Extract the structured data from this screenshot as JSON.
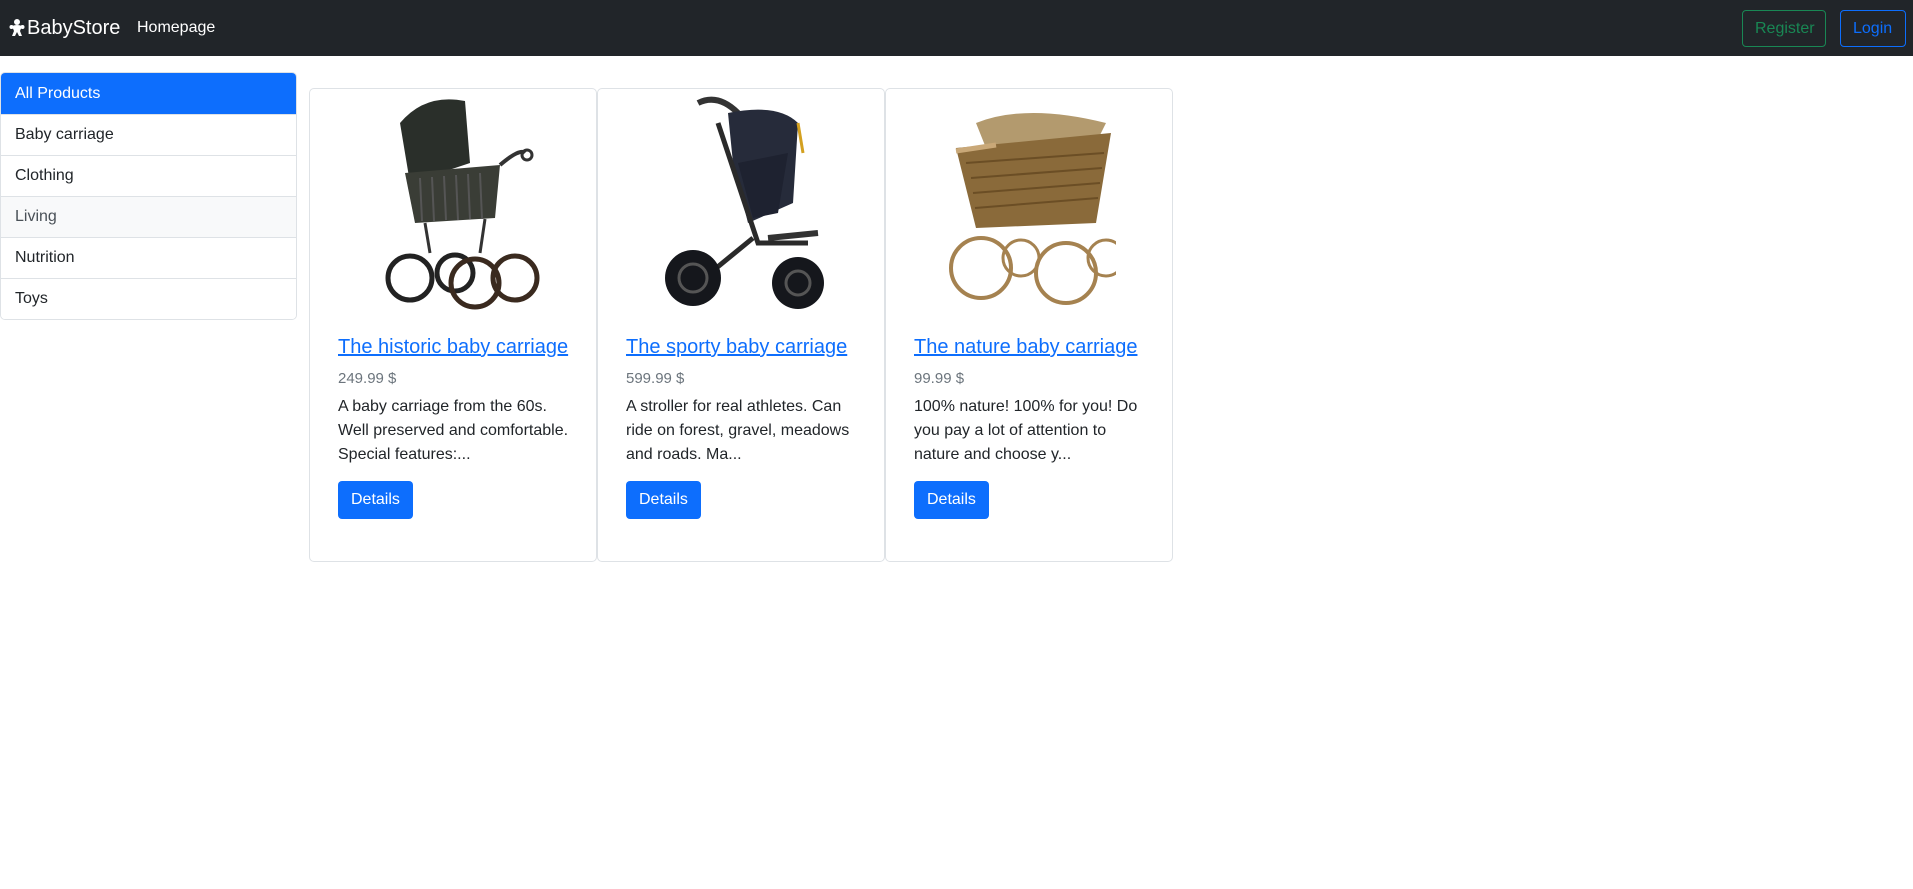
{
  "navbar": {
    "brand": "BabyStore",
    "homepage_link": "Homepage",
    "register_button": "Register",
    "login_button": "Login"
  },
  "sidebar": {
    "items": [
      {
        "label": "All Products",
        "state": "active"
      },
      {
        "label": "Baby carriage",
        "state": "default"
      },
      {
        "label": "Clothing",
        "state": "default"
      },
      {
        "label": "Living",
        "state": "hover"
      },
      {
        "label": "Nutrition",
        "state": "default"
      },
      {
        "label": "Toys",
        "state": "default"
      }
    ]
  },
  "products": [
    {
      "title": "The historic baby carriage",
      "price": "249.99 $",
      "description": "A baby carriage from the 60s. Well preserved and comfortable. Special features:...",
      "button": "Details",
      "image_icon": "historic-pram-image"
    },
    {
      "title": "The sporty baby carriage",
      "price": "599.99 $",
      "description": "A stroller for real athletes. Can ride on forest, gravel, meadows and roads. Ma...",
      "button": "Details",
      "image_icon": "jogging-stroller-image"
    },
    {
      "title": "The nature baby carriage",
      "price": "99.99 $",
      "description": "100% nature! 100% for you! Do you pay a lot of attention to nature and choose y...",
      "button": "Details",
      "image_icon": "wicker-pram-image"
    }
  ],
  "colors": {
    "navbar_bg": "#212529",
    "primary": "#0d6efd",
    "success": "#198754",
    "muted": "#6c757d"
  }
}
